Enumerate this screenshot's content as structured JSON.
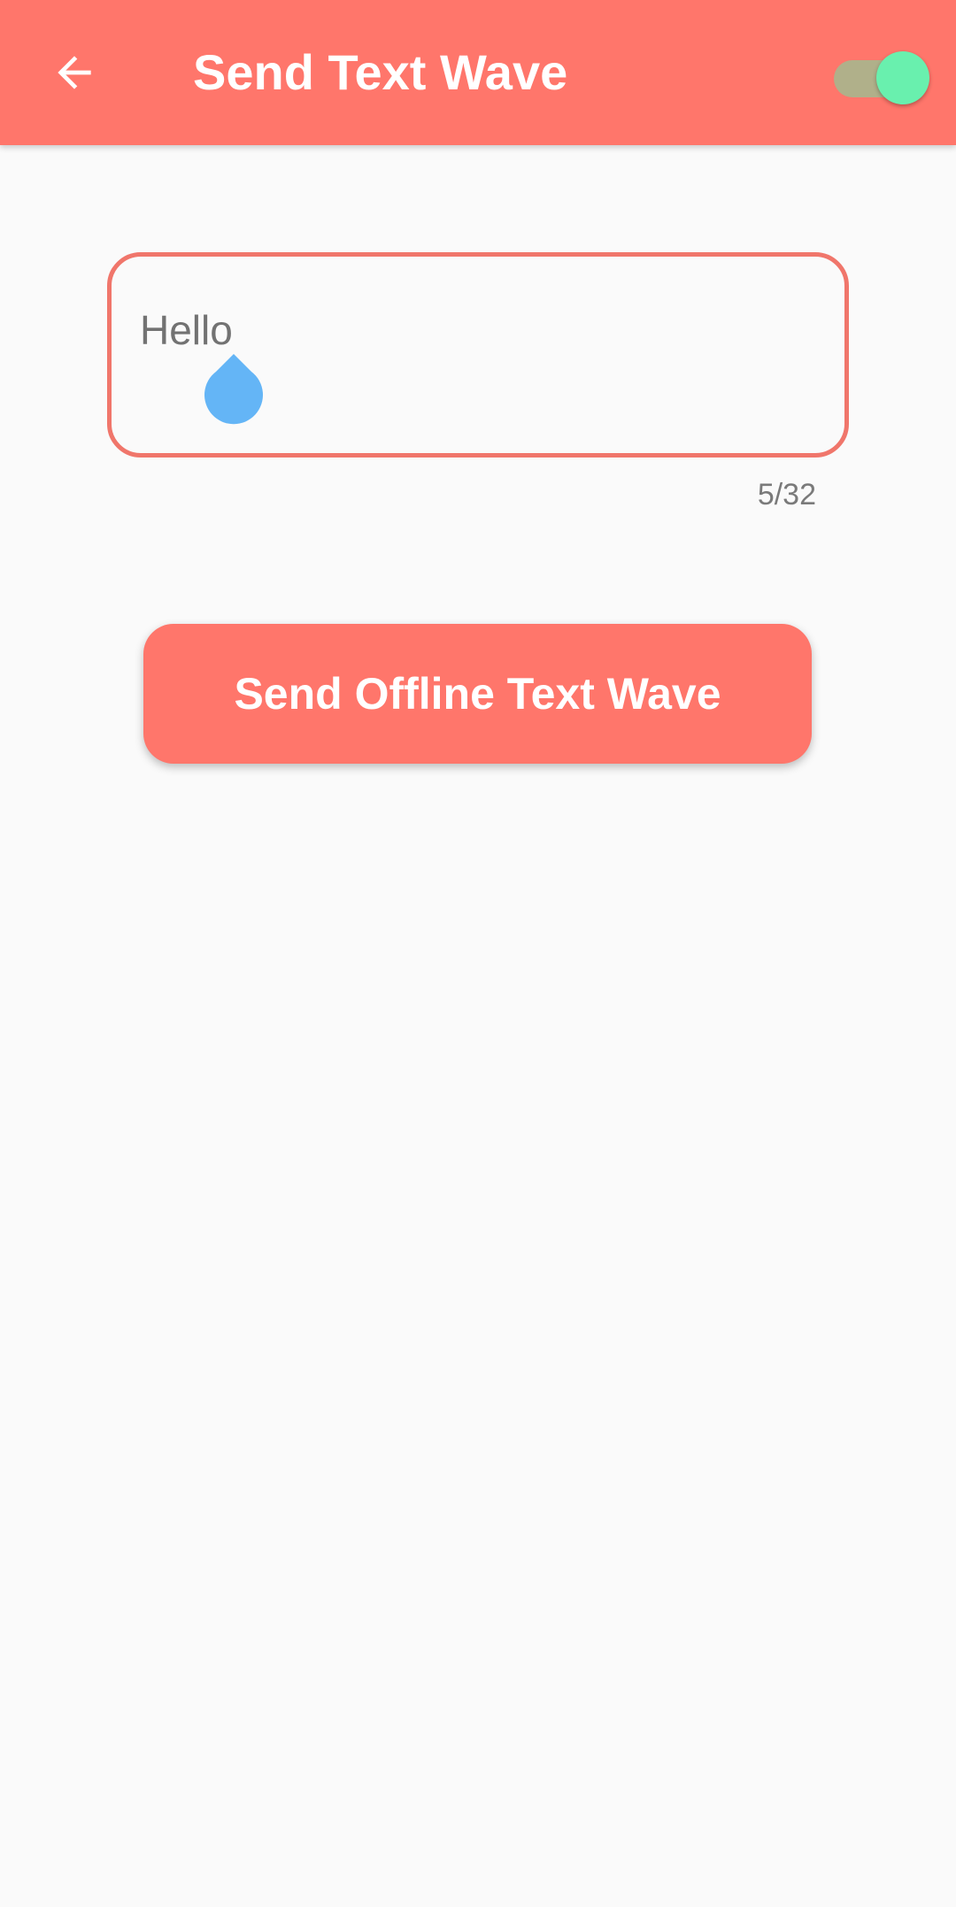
{
  "appbar": {
    "title": "Send Text Wave",
    "back_icon": "arrow-back-icon",
    "toggle": {
      "state": "on",
      "track_color": "#b0b08a",
      "thumb_color": "#69f0ae"
    },
    "background_color": "#ff766b"
  },
  "message_input": {
    "value": "Hello",
    "counter": "5/32",
    "cursor_icon": "text-cursor-handle-icon",
    "border_color": "#f0766b"
  },
  "send_button": {
    "label": "Send Offline Text Wave",
    "color": "#ff766b"
  }
}
